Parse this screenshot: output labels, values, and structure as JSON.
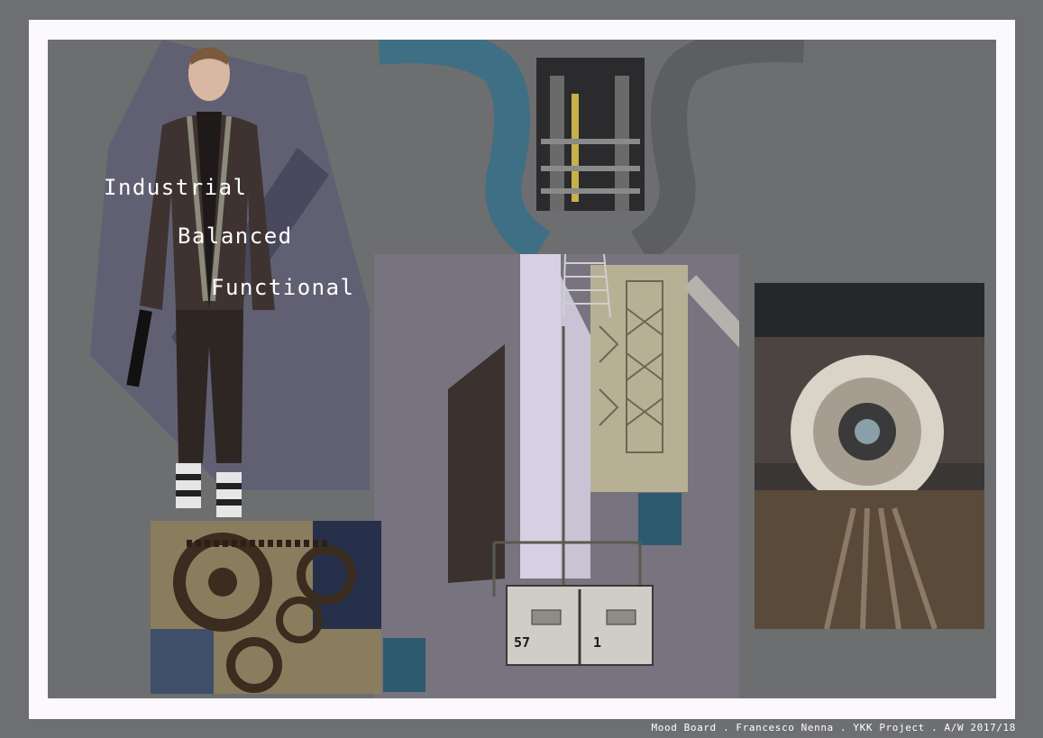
{
  "keywords": {
    "first": "Industrial",
    "second": "Balanced",
    "third": "Functional"
  },
  "footer": {
    "caption": "Mood Board . Francesco Nenna . YKK Project . A/W 2017/18"
  },
  "stamps": {
    "left_number": "57",
    "right_number": "1"
  },
  "colors": {
    "page_bg": "#6e6f71",
    "frame": "#fcf9fc",
    "board": "#6d6e70",
    "accent_teal": "#2e5a70",
    "lavender": "#c9c3d6"
  }
}
